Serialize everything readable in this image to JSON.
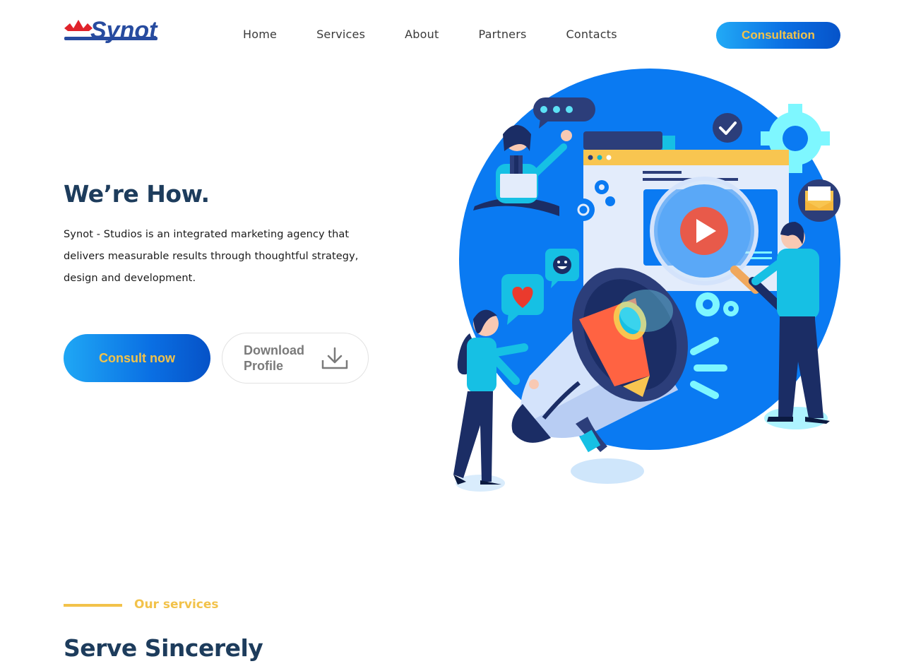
{
  "header": {
    "logo_text": "Synot",
    "nav": [
      {
        "label": "Home"
      },
      {
        "label": "Services"
      },
      {
        "label": "About"
      },
      {
        "label": "Partners"
      },
      {
        "label": "Contacts"
      }
    ],
    "cta_label": "Consultation"
  },
  "hero": {
    "title": "We’re How.",
    "description": "Synot - Studios is an integrated marketing agency that delivers measurable results through thoughtful strategy, design and development.",
    "consult_label": "Consult now",
    "download_label": "Download Profile"
  },
  "services": {
    "label": "Our services",
    "title": "Serve Sincerely"
  },
  "colors": {
    "brand_navy": "#1d3c5c",
    "accent_gold": "#f2c24a",
    "primary_blue": "#0a6fe3",
    "logo_red": "#e0232b",
    "logo_blue": "#274b9f"
  },
  "icons": [
    "download-icon",
    "play-icon",
    "heart-icon",
    "gear-icon",
    "check-icon",
    "chat-bubble-icon",
    "smile-icon",
    "mail-icon",
    "megaphone-icon"
  ]
}
